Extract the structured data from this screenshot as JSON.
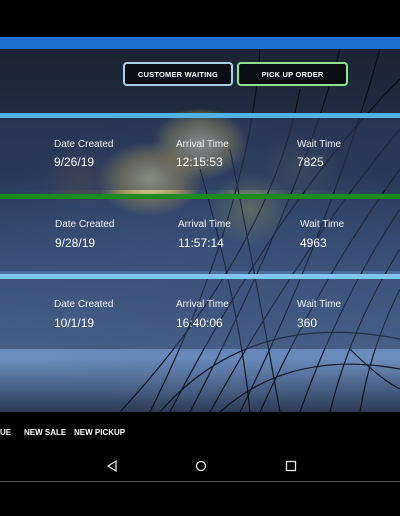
{
  "header": {
    "customer_waiting_label": "CUSTOMER WAITING",
    "pick_up_order_label": "PICK UP ORDER"
  },
  "columns": {
    "date_created": "Date Created",
    "arrival_time": "Arrival Time",
    "wait_time": "Wait Time"
  },
  "orders": [
    {
      "date_created": "9/26/19",
      "arrival_time": "12:15:53",
      "wait_time": "7825",
      "divider_color": "#4fb4e6"
    },
    {
      "date_created": "9/28/19",
      "arrival_time": "11:57:14",
      "wait_time": "4963",
      "divider_color": "#1f8a1f"
    },
    {
      "date_created": "10/1/19",
      "arrival_time": "16:40:06",
      "wait_time": "360",
      "divider_color": "#7fc6ec"
    }
  ],
  "bottom_nav": {
    "queue_label": "UE",
    "new_sale_label": "NEW SALE",
    "new_pickup_label": "NEW PICKUP"
  },
  "system_nav": {
    "back_icon": "back-triangle-icon",
    "home_icon": "home-circle-icon",
    "recents_icon": "recents-square-icon"
  },
  "colors": {
    "accent_bar": "#1f6fd0",
    "customer_waiting_border": "#a9d2e6",
    "pick_up_order_border": "#8fe38a"
  }
}
